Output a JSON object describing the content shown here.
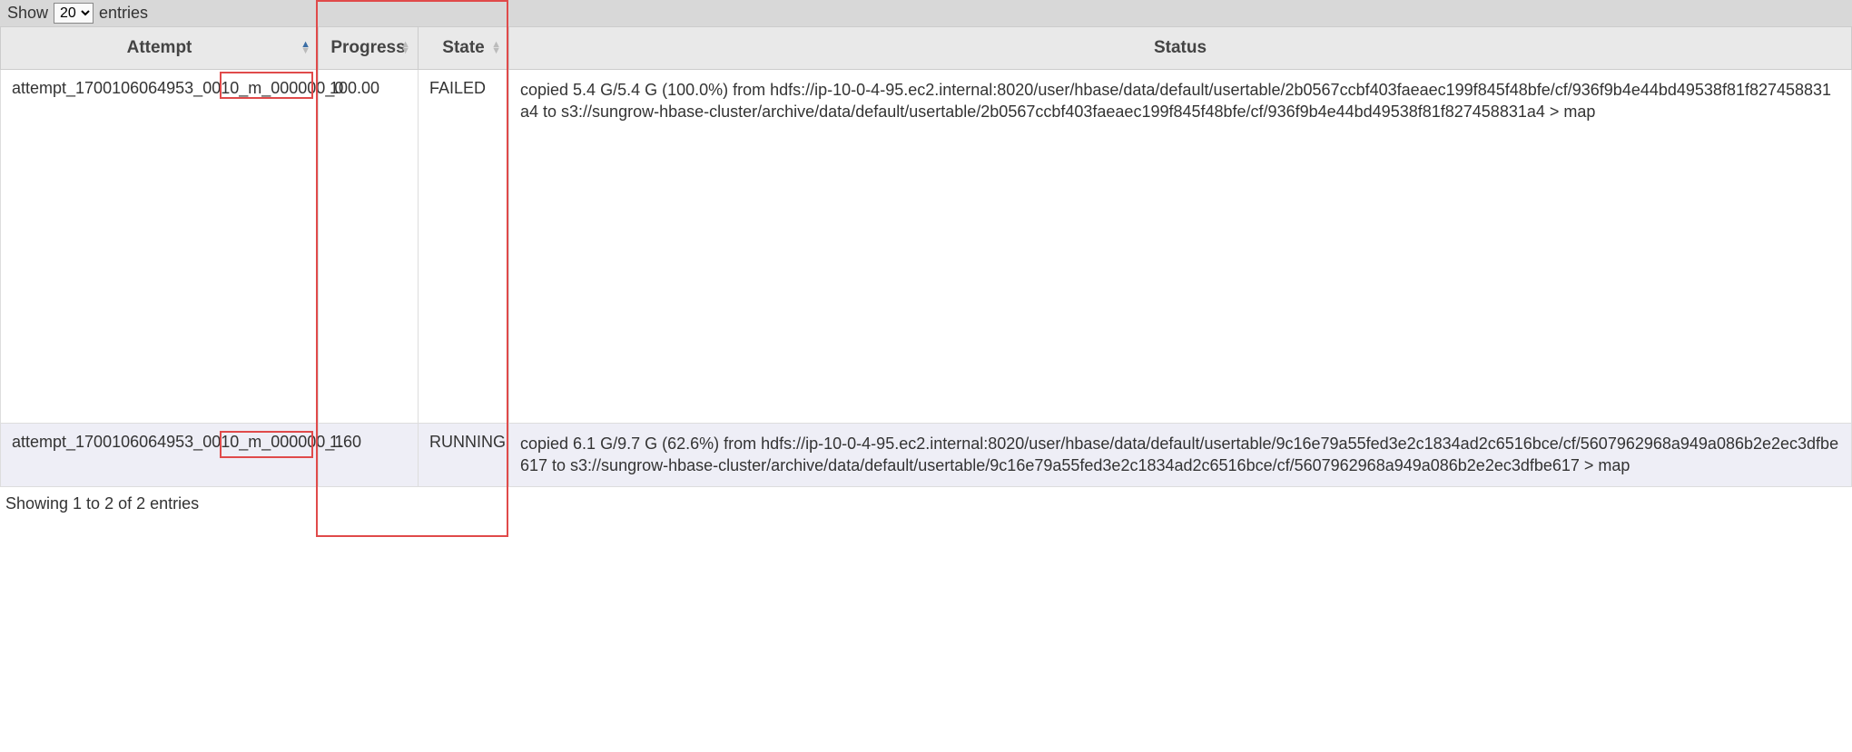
{
  "length_control": {
    "show_label": "Show",
    "entries_label": "entries",
    "selected": "20"
  },
  "columns": {
    "attempt": "Attempt",
    "progress": "Progress",
    "state": "State",
    "status": "Status"
  },
  "rows": [
    {
      "attempt": "attempt_1700106064953_0010_m_000000_0",
      "progress": "100.00",
      "state": "FAILED",
      "status": "copied 5.4 G/5.4 G (100.0%) from hdfs://ip-10-0-4-95.ec2.internal:8020/user/hbase/data/default/usertable/2b0567ccbf403faeaec199f845f48bfe/cf/936f9b4e44bd49538f81f827458831a4 to s3://sungrow-hbase-cluster/archive/data/default/usertable/2b0567ccbf403faeaec199f845f48bfe/cf/936f9b4e44bd49538f81f827458831a4 > map"
    },
    {
      "attempt": "attempt_1700106064953_0010_m_000000_1",
      "progress": "1.60",
      "state": "RUNNING",
      "status": "copied 6.1 G/9.7 G (62.6%) from hdfs://ip-10-0-4-95.ec2.internal:8020/user/hbase/data/default/usertable/9c16e79a55fed3e2c1834ad2c6516bce/cf/5607962968a949a086b2e2ec3dfbe617 to s3://sungrow-hbase-cluster/archive/data/default/usertable/9c16e79a55fed3e2c1834ad2c6516bce/cf/5607962968a949a086b2e2ec3dfbe617 > map"
    }
  ],
  "footer": {
    "info": "Showing 1 to 2 of 2 entries"
  }
}
